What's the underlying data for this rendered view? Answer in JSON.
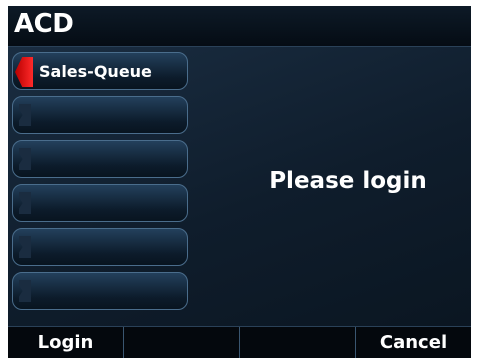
{
  "header": {
    "title": "ACD"
  },
  "lines": [
    {
      "label": "Sales-Queue",
      "active": true
    },
    {
      "label": "",
      "active": false
    },
    {
      "label": "",
      "active": false
    },
    {
      "label": "",
      "active": false
    },
    {
      "label": "",
      "active": false
    },
    {
      "label": "",
      "active": false
    }
  ],
  "main": {
    "message": "Please login"
  },
  "softkeys": [
    {
      "label": "Login"
    },
    {
      "label": ""
    },
    {
      "label": ""
    },
    {
      "label": "Cancel"
    }
  ],
  "colors": {
    "active_indicator": "#e00000",
    "background": "#132436"
  }
}
